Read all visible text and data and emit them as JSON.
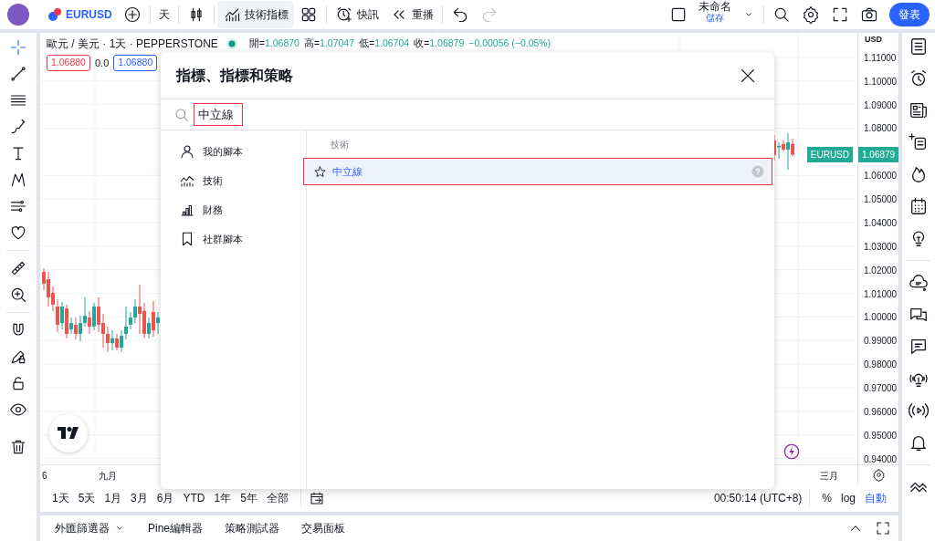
{
  "top_bar": {
    "symbol": "EURUSD",
    "interval": "天",
    "indicators": {
      "label": "技術指標",
      "selected": true
    },
    "alert_label": "快訊",
    "replay_label": "重播",
    "undo": {
      "disabled": false
    },
    "redo": {
      "disabled": true
    },
    "layout_name": "未命名",
    "save_label": "儲存",
    "publish_label": "發表"
  },
  "legend": {
    "title": "歐元 / 美元 · 1天 · PEPPERSTONE",
    "ohlc": [
      {
        "label": "開=",
        "value": "1.06870"
      },
      {
        "label": "高=",
        "value": "1.07047"
      },
      {
        "label": "低=",
        "value": "1.06704"
      },
      {
        "label": "收=",
        "value": "1.06879"
      }
    ],
    "change": "−0.00056 (−0.05%)",
    "sell": "1.06880",
    "spread": "0.0",
    "buy": "1.06880"
  },
  "price_axis": {
    "currency": "USD",
    "symbol_tag": "EURUSD",
    "last_price": "1.06879"
  },
  "ranges": [
    "1天",
    "5天",
    "1月",
    "3月",
    "6月",
    "YTD",
    "1年",
    "5年",
    "全部"
  ],
  "clock": "00:50:14 (UTC+8)",
  "scale_options": [
    {
      "label": "%",
      "selected": false
    },
    {
      "label": "log",
      "selected": false
    },
    {
      "label": "自動",
      "selected": true
    }
  ],
  "bottom_tabs": [
    {
      "label": "外匯篩選器",
      "dropdown": true
    },
    {
      "label": "Pine編輯器",
      "dropdown": false
    },
    {
      "label": "策略測試器",
      "dropdown": false
    },
    {
      "label": "交易面板",
      "dropdown": false
    }
  ],
  "chart": {
    "chart_data": {
      "type": "candlestick",
      "grid": true,
      "ylim": [
        0.9379,
        1.1204
      ],
      "categories": [
        "6",
        null,
        null,
        null,
        null,
        null,
        null,
        null,
        null,
        null,
        null,
        null,
        null,
        null,
        "九月",
        null,
        null,
        null,
        null,
        null,
        null,
        null,
        null,
        null,
        null,
        null,
        null,
        null,
        null,
        null,
        null,
        null,
        null,
        null,
        null,
        null,
        null,
        null,
        null,
        null,
        null,
        null,
        null,
        null,
        null,
        null,
        null,
        null,
        null,
        null,
        null,
        null,
        null,
        null,
        null,
        null,
        null,
        null,
        null,
        null,
        null,
        null,
        null,
        null,
        null,
        null,
        null,
        null,
        null,
        null,
        null,
        null,
        null,
        null,
        null,
        null,
        null,
        null,
        null,
        null,
        null,
        null,
        null,
        null,
        null,
        null,
        null,
        null,
        null,
        null,
        null,
        null,
        null,
        null,
        null,
        null,
        null,
        null,
        null,
        null,
        null,
        null,
        null,
        null,
        null,
        null,
        null,
        null,
        null,
        null,
        null,
        null,
        null,
        null,
        null,
        null,
        null,
        null,
        null,
        null,
        null,
        null,
        null,
        null,
        null,
        null,
        null,
        null,
        null,
        null,
        null,
        null,
        null,
        null,
        null,
        null,
        null,
        null,
        null,
        null,
        null,
        null,
        null,
        null,
        null,
        null,
        null,
        null,
        null,
        null,
        null,
        null,
        null,
        null,
        null,
        null,
        null,
        null,
        null,
        null,
        null,
        null,
        null,
        null,
        null,
        null,
        null,
        null,
        null,
        null,
        null,
        null,
        "三月",
        null,
        null,
        null,
        null,
        null
      ],
      "ohlc": [
        [
          1.0191,
          1.0206,
          1.0114,
          1.0141
        ],
        [
          1.016,
          1.0191,
          1.0044,
          1.0083
        ],
        [
          1.0102,
          1.0129,
          1.0025,
          1.0052
        ],
        [
          1.0044,
          1.0075,
          0.9936,
          0.9967
        ],
        [
          0.9974,
          1.0063,
          0.9947,
          1.0044
        ],
        [
          1.0036,
          1.0052,
          0.9909,
          0.9928
        ],
        [
          0.9947,
          0.9997,
          0.9928,
          0.9974
        ],
        [
          0.9967,
          0.9997,
          0.9905,
          0.9928
        ],
        [
          0.9928,
          1.0005,
          0.9897,
          0.9974
        ],
        [
          0.9974,
          1.0083,
          0.9959,
          1.0005
        ],
        [
          0.9997,
          1.0025,
          0.9928,
          0.9959
        ],
        [
          0.9959,
          1.0059,
          0.9943,
          1.0044
        ],
        [
          1.0044,
          1.0083,
          0.9936,
          0.9967
        ],
        [
          0.9974,
          1.0013,
          0.987,
          0.9928
        ],
        [
          0.9928,
          0.9959,
          0.9851,
          0.9889
        ],
        [
          0.9889,
          0.9943,
          0.9858,
          0.9909
        ],
        [
          0.9909,
          0.9928,
          0.9858,
          0.987
        ],
        [
          0.987,
          0.9943,
          0.9851,
          0.992
        ],
        [
          0.9928,
          1.0044,
          0.9905,
          0.9959
        ],
        [
          0.9967,
          1.0021,
          0.9947,
          0.9997
        ],
        [
          0.9997,
          1.0075,
          0.9974,
          1.0044
        ],
        [
          1.0044,
          1.0137,
          0.9928,
          1.0013
        ],
        [
          1.0025,
          1.0059,
          0.9909,
          0.9928
        ],
        [
          0.9928,
          0.9997,
          0.9909,
          0.9974
        ],
        [
          1.0021,
          1.0067,
          0.9916,
          0.9943
        ],
        [
          0.9974,
          1.0021,
          0.9928,
          0.9997
        ],
        null,
        null,
        null,
        null,
        null,
        null,
        null,
        null,
        null,
        null,
        null,
        null,
        null,
        null,
        null,
        null,
        null,
        null,
        null,
        null,
        null,
        null,
        null,
        null,
        null,
        null,
        null,
        null,
        null,
        null,
        null,
        null,
        null,
        null,
        null,
        null,
        null,
        null,
        null,
        null,
        null,
        null,
        null,
        null,
        null,
        null,
        null,
        null,
        null,
        null,
        null,
        null,
        null,
        null,
        null,
        null,
        null,
        null,
        null,
        null,
        null,
        null,
        null,
        null,
        null,
        null,
        null,
        null,
        null,
        null,
        null,
        null,
        null,
        null,
        null,
        null,
        null,
        null,
        null,
        null,
        null,
        null,
        null,
        null,
        null,
        null,
        null,
        null,
        null,
        null,
        null,
        null,
        null,
        null,
        null,
        null,
        null,
        null,
        null,
        null,
        null,
        null,
        null,
        null,
        null,
        null,
        null,
        null,
        null,
        null,
        null,
        null,
        null,
        null,
        null,
        null,
        null,
        null,
        null,
        null,
        null,
        null,
        null,
        null,
        null,
        null,
        null,
        null,
        null,
        null,
        null,
        null,
        null,
        null,
        [
          1.0748,
          1.0771,
          1.0663,
          1.0686
        ],
        [
          1.0725,
          1.074,
          1.0671,
          1.0725
        ],
        [
          1.0733,
          1.0748,
          1.0702,
          1.0709
        ],
        [
          1.0709,
          1.0779,
          1.0624,
          1.074
        ],
        [
          1.0733,
          1.0756,
          1.068,
          1.0688
        ],
        null,
        null,
        null,
        null,
        null,
        null,
        null,
        null,
        null,
        null,
        null,
        null,
        null
      ],
      "yticks": [
        {
          "value": 1.11,
          "label": "1.11000"
        },
        {
          "value": 1.1,
          "label": "1.10000"
        },
        {
          "value": 1.09,
          "label": "1.09000"
        },
        {
          "value": 1.08,
          "label": "1.08000"
        },
        {
          "value": 1.06,
          "label": "1.06000"
        },
        {
          "value": 1.05,
          "label": "1.05000"
        },
        {
          "value": 1.04,
          "label": "1.04000"
        },
        {
          "value": 1.03,
          "label": "1.03000"
        },
        {
          "value": 1.02,
          "label": "1.02000"
        },
        {
          "value": 1.01,
          "label": "1.01000"
        },
        {
          "value": 1.0,
          "label": "1.00000"
        },
        {
          "value": 0.99,
          "label": "0.99000"
        },
        {
          "value": 0.98,
          "label": "0.98000"
        },
        {
          "value": 0.97,
          "label": "0.97000"
        },
        {
          "value": 0.96,
          "label": "0.96000"
        },
        {
          "value": 0.95,
          "label": "0.95000"
        },
        {
          "value": 0.94,
          "label": "0.94000"
        }
      ]
    }
  },
  "dialog": {
    "title": "指標、指標和策略",
    "search": "中立線",
    "categories": [
      {
        "kind": "person",
        "label": "我的腳本"
      },
      {
        "kind": "technical",
        "label": "技術"
      },
      {
        "kind": "financial",
        "label": "財務"
      },
      {
        "kind": "bookmark",
        "label": "社群腳本"
      }
    ],
    "section": "技術",
    "results": [
      {
        "label": "中立線",
        "selected": true
      }
    ]
  }
}
